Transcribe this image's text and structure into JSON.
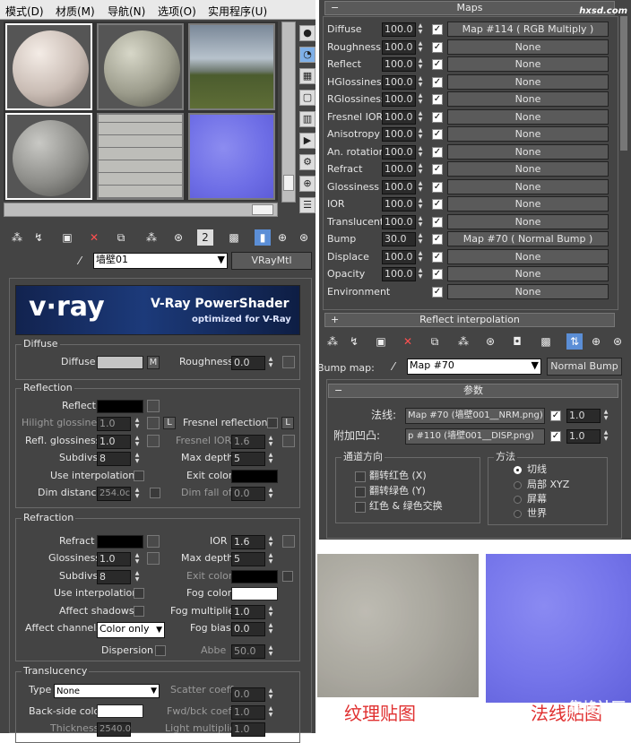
{
  "menu": [
    "模式(D)",
    "材质(M)",
    "导航(N)",
    "选项(O)",
    "实用程序(U)"
  ],
  "material": {
    "name": "墙壁01",
    "type": "VRayMtl"
  },
  "banner": {
    "brand": "v·ray",
    "title": "V-Ray PowerShader",
    "subtitle": "optimized for V-Ray"
  },
  "diffuse": {
    "group": "Diffuse",
    "label": "Diffuse",
    "map_btn": "M",
    "roughness_label": "Roughness",
    "roughness": "0.0"
  },
  "reflection": {
    "group": "Reflection",
    "reflect": "Reflect",
    "hilight_label": "Hilight glossiness",
    "hilight": "1.0",
    "lock": "L",
    "fresnel_label": "Fresnel reflections",
    "fresnel_lock": "L",
    "refl_gloss_label": "Refl. glossiness",
    "refl_gloss": "1.0",
    "fresnel_ior_label": "Fresnel IOR",
    "fresnel_ior": "1.6",
    "subdivs_label": "Subdivs",
    "subdivs": "8",
    "max_depth_label": "Max depth",
    "max_depth": "5",
    "use_interp": "Use interpolation",
    "exit_color": "Exit color",
    "dim_distance_label": "Dim distance",
    "dim_distance": "254.0c",
    "dim_falloff_label": "Dim fall off",
    "dim_falloff": "0.0"
  },
  "refraction": {
    "group": "Refraction",
    "refract": "Refract",
    "ior_label": "IOR",
    "ior": "1.6",
    "gloss_label": "Glossiness",
    "gloss": "1.0",
    "max_depth_label": "Max depth",
    "max_depth": "5",
    "subdivs_label": "Subdivs",
    "subdivs": "8",
    "exit_color": "Exit color",
    "use_interp": "Use interpolation",
    "fog_color": "Fog color",
    "affect_shadows": "Affect shadows",
    "fog_mult_label": "Fog multiplier",
    "fog_mult": "1.0",
    "affect_channels_label": "Affect channels",
    "affect_channels": "Color only",
    "fog_bias_label": "Fog bias",
    "fog_bias": "0.0",
    "dispersion": "Dispersion",
    "abbe_label": "Abbe",
    "abbe": "50.0"
  },
  "translucency": {
    "group": "Translucency",
    "type_label": "Type",
    "type": "None",
    "scatter_label": "Scatter coeff",
    "scatter": "0.0",
    "backside_label": "Back-side color",
    "fwd_label": "Fwd/bck coeff",
    "fwd": "1.0",
    "thickness_label": "Thickness",
    "thickness": "2540.0",
    "light_mult_label": "Light multiplier",
    "light_mult": "1.0"
  },
  "maps": {
    "title": "Maps",
    "rows": [
      {
        "label": "Diffuse",
        "value": "100.0",
        "map": "Map #114  ( RGB Multiply )"
      },
      {
        "label": "Roughness",
        "value": "100.0",
        "map": "None"
      },
      {
        "label": "Reflect",
        "value": "100.0",
        "map": "None"
      },
      {
        "label": "HGlossiness",
        "value": "100.0",
        "map": "None"
      },
      {
        "label": "RGlossiness",
        "value": "100.0",
        "map": "None"
      },
      {
        "label": "Fresnel IOR",
        "value": "100.0",
        "map": "None"
      },
      {
        "label": "Anisotropy",
        "value": "100.0",
        "map": "None"
      },
      {
        "label": "An. rotation",
        "value": "100.0",
        "map": "None"
      },
      {
        "label": "Refract",
        "value": "100.0",
        "map": "None"
      },
      {
        "label": "Glossiness",
        "value": "100.0",
        "map": "None"
      },
      {
        "label": "IOR",
        "value": "100.0",
        "map": "None"
      },
      {
        "label": "Translucent",
        "value": "100.0",
        "map": "None"
      },
      {
        "label": "Bump",
        "value": "30.0",
        "map": "Map #70  ( Normal Bump )"
      },
      {
        "label": "Displace",
        "value": "100.0",
        "map": "None"
      },
      {
        "label": "Opacity",
        "value": "100.0",
        "map": "None"
      },
      {
        "label": "Environment",
        "value": "",
        "map": "None"
      }
    ]
  },
  "reflect_interp": "Reflect interpolation",
  "bump": {
    "label": "Bump map:",
    "name": "Map #70",
    "type": "Normal Bump"
  },
  "params": {
    "title": "参数",
    "normal_label": "法线:",
    "normal_map": "Map #70 (墙壁001__NRM.png)",
    "normal_val": "1.0",
    "extra_label": "附加凹凸:",
    "extra_map": "p #110 (墙壁001__DISP.png)",
    "extra_val": "1.0",
    "channel_dir": "通道方向",
    "flip_red": "翻转红色 (X)",
    "flip_green": "翻转绿色 (Y)",
    "swap_rg": "红色 & 绿色交换",
    "method": "方法",
    "methods": [
      "切线",
      "局部 XYZ",
      "屏幕",
      "世界"
    ]
  },
  "captions": {
    "texture": "纹理贴图",
    "normal": "法线贴图",
    "watermark_site": "hxsd.com",
    "watermark_bottom": "集峰社区"
  },
  "colors": {
    "panel": "#444444",
    "caption_red": "#e03030"
  }
}
